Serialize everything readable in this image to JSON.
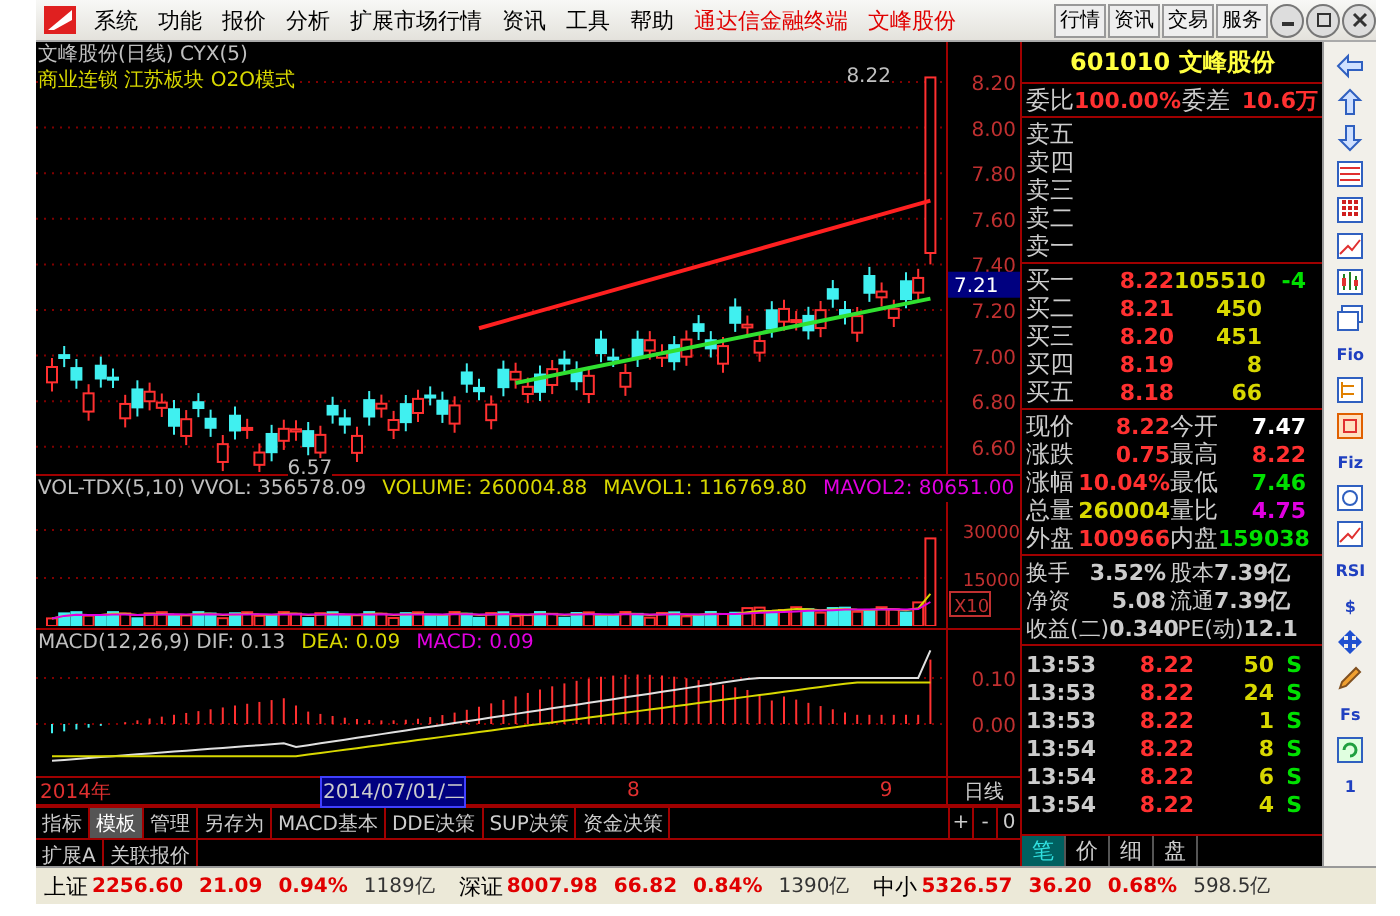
{
  "menu": {
    "items": [
      "系统",
      "功能",
      "报价",
      "分析",
      "扩展市场行情",
      "资讯",
      "工具",
      "帮助"
    ],
    "brand": "通达信金融终端",
    "stock": "文峰股份",
    "tabs": [
      "行情",
      "资讯",
      "交易",
      "服务"
    ]
  },
  "price_panel": {
    "title": "文峰股份(日线) CYX(5)",
    "tags": "商业连锁 江苏板块 O2O模式",
    "high_label": "8.22",
    "low_label": "6.57",
    "ticks": [
      "8.20",
      "8.00",
      "7.80",
      "7.60",
      "7.40",
      "7.20",
      "7.00",
      "6.80",
      "6.60"
    ],
    "current_price": "7.21"
  },
  "volume_panel": {
    "indicators": [
      {
        "text": "VOL-TDX(5,10) VVOL: 356578.09",
        "color": "#c0c0c0"
      },
      {
        "text": "VOLUME: 260004.88",
        "color": "#d8d800"
      },
      {
        "text": "MAVOL1: 116769.80",
        "color": "#d8d800"
      },
      {
        "text": "MAVOL2: 80651.00",
        "color": "#e000e0"
      }
    ],
    "ticks": [
      "30000",
      "15000"
    ],
    "unit": "X10"
  },
  "macd_panel": {
    "indicators": [
      {
        "text": "MACD(12,26,9) DIF: 0.13",
        "color": "#c0c0c0"
      },
      {
        "text": "DEA: 0.09",
        "color": "#d8d800"
      },
      {
        "text": "MACD: 0.09",
        "color": "#e000e0"
      }
    ],
    "ticks": [
      "0.10",
      "0.00"
    ]
  },
  "date_axis": {
    "labels": [
      {
        "text": "2014年",
        "selected": false
      },
      {
        "text": "2014/07/01/二",
        "selected": true
      },
      {
        "text": "8",
        "selected": false
      },
      {
        "text": "9",
        "selected": false
      }
    ],
    "period": "日线"
  },
  "bottom_tabs": [
    {
      "label": "指标",
      "selected": false
    },
    {
      "label": "模板",
      "selected": true
    },
    {
      "label": "管理",
      "selected": false
    },
    {
      "label": "另存为",
      "selected": false
    },
    {
      "label": "MACD基本",
      "selected": false
    },
    {
      "label": "DDE决策",
      "selected": false
    },
    {
      "label": "SUP决策",
      "selected": false
    },
    {
      "label": "资金决策",
      "selected": false
    }
  ],
  "zoom_buttons": [
    "+",
    "-",
    "0"
  ],
  "extra_tabs": [
    "扩展A",
    "关联报价"
  ],
  "quote": {
    "header": "601010 文峰股份",
    "ratio_label": "委比",
    "ratio": "100.00%",
    "diff_label": "委差",
    "diff": "10.6万",
    "sells": [
      "卖五",
      "卖四",
      "卖三",
      "卖二",
      "卖一"
    ],
    "buys": [
      {
        "label": "买一",
        "price": "8.22",
        "volume": "105510",
        "change": "-4"
      },
      {
        "label": "买二",
        "price": "8.21",
        "volume": "450"
      },
      {
        "label": "买三",
        "price": "8.20",
        "volume": "451"
      },
      {
        "label": "买四",
        "price": "8.19",
        "volume": "8"
      },
      {
        "label": "买五",
        "price": "8.18",
        "volume": "66"
      }
    ],
    "stats": [
      [
        {
          "label": "现价",
          "value": "8.22",
          "color": "#ff3030"
        },
        {
          "label": "今开",
          "value": "7.47",
          "color": "#ffffff"
        }
      ],
      [
        {
          "label": "涨跌",
          "value": "0.75",
          "color": "#ff3030"
        },
        {
          "label": "最高",
          "value": "8.22",
          "color": "#ff3030"
        }
      ],
      [
        {
          "label": "涨幅",
          "value": "10.04%",
          "color": "#ff3030"
        },
        {
          "label": "最低",
          "value": "7.46",
          "color": "#00e000"
        }
      ],
      [
        {
          "label": "总量",
          "value": "260004",
          "color": "#d8d800"
        },
        {
          "label": "量比",
          "value": "4.75",
          "color": "#e000e0"
        }
      ],
      [
        {
          "label": "外盘",
          "value": "100966",
          "color": "#ff3030"
        },
        {
          "label": "内盘",
          "value": "159038",
          "color": "#00e000"
        }
      ]
    ],
    "info": [
      {
        "l1": "换手",
        "v1": "3.52%",
        "l2": "股本",
        "v2": "7.39亿"
      },
      {
        "l1": "净资",
        "v1": "5.08",
        "l2": "流通",
        "v2": "7.39亿"
      },
      {
        "l1": "收益(二)",
        "v1": "0.340",
        "l2": "PE(动)",
        "v2": "12.1"
      }
    ],
    "trades": [
      {
        "time": "13:53",
        "price": "8.22",
        "volume": "50",
        "side": "S"
      },
      {
        "time": "13:53",
        "price": "8.22",
        "volume": "24",
        "side": "S"
      },
      {
        "time": "13:53",
        "price": "8.22",
        "volume": "1",
        "side": "S"
      },
      {
        "time": "13:54",
        "price": "8.22",
        "volume": "8",
        "side": "S"
      },
      {
        "time": "13:54",
        "price": "8.22",
        "volume": "6",
        "side": "S"
      },
      {
        "time": "13:54",
        "price": "8.22",
        "volume": "4",
        "side": "S"
      }
    ],
    "tabs": [
      {
        "label": "笔",
        "selected": true
      },
      {
        "label": "价",
        "selected": false
      },
      {
        "label": "细",
        "selected": false
      },
      {
        "label": "盘",
        "selected": false
      }
    ]
  },
  "toolbar": [
    {
      "kind": "back"
    },
    {
      "kind": "up"
    },
    {
      "kind": "down"
    },
    {
      "kind": "table"
    },
    {
      "kind": "grid"
    },
    {
      "kind": "line"
    },
    {
      "kind": "candles"
    },
    {
      "kind": "window"
    },
    {
      "kind": "label",
      "label": "Fio"
    },
    {
      "kind": "tree"
    },
    {
      "kind": "box"
    },
    {
      "kind": "label",
      "label": "Fiz"
    },
    {
      "kind": "circle"
    },
    {
      "kind": "line"
    },
    {
      "kind": "label",
      "label": "RSI"
    },
    {
      "kind": "label",
      "label": "$"
    },
    {
      "kind": "move"
    },
    {
      "kind": "pencil"
    },
    {
      "kind": "label",
      "label": "Fs"
    },
    {
      "kind": "refresh"
    },
    {
      "kind": "label",
      "label": "1"
    }
  ],
  "status": [
    {
      "name": "上证",
      "value": "2256.60",
      "change": "21.09",
      "percent": "0.94%",
      "amount": "1189亿"
    },
    {
      "name": "深证",
      "value": "8007.98",
      "change": "66.82",
      "percent": "0.84%",
      "amount": "1390亿"
    },
    {
      "name": "中小",
      "value": "5326.57",
      "change": "36.20",
      "percent": "0.68%",
      "amount": "598.5亿"
    }
  ]
}
